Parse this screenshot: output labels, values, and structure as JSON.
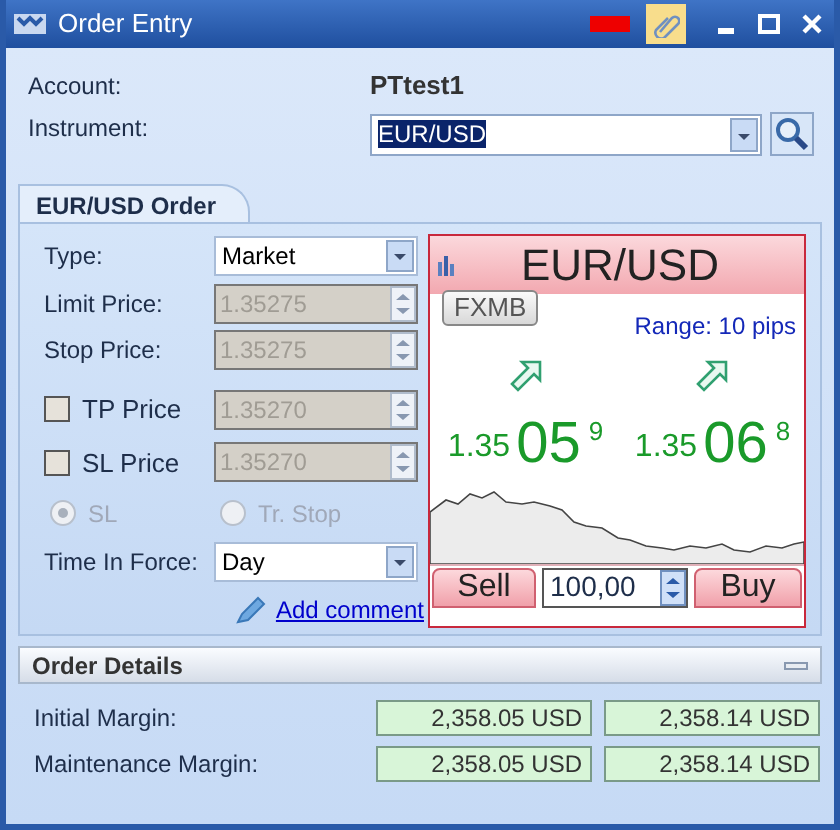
{
  "window": {
    "title": "Order Entry"
  },
  "account": {
    "label": "Account:",
    "value": "PTtest1"
  },
  "instrument": {
    "label": "Instrument:",
    "value": "EUR/USD"
  },
  "tabs": [
    {
      "label": "EUR/USD Order",
      "selected": true
    }
  ],
  "fields": [
    {
      "kind": "select",
      "label": "Type:",
      "value": "Market",
      "disabled": false
    },
    {
      "kind": "spin",
      "label": "Limit Price:",
      "value": "1.35275",
      "disabled": true
    },
    {
      "kind": "spin",
      "label": "Stop Price:",
      "value": "1.35275",
      "disabled": true
    },
    {
      "kind": "check_spin",
      "label": "TP Price",
      "checked": false,
      "value": "1.35270",
      "disabled": true
    },
    {
      "kind": "check_spin",
      "label": "SL Price",
      "checked": false,
      "value": "1.35270",
      "disabled": true
    },
    {
      "kind": "radios",
      "disabled": true,
      "options": [
        {
          "label": "SL",
          "selected": true
        },
        {
          "label": "Tr. Stop",
          "selected": false
        }
      ]
    },
    {
      "kind": "select",
      "label": "Time In Force:",
      "value": "Day",
      "disabled": false
    }
  ],
  "add_comment": "Add comment",
  "quote": {
    "symbol": "EUR/USD",
    "source": "FXMB",
    "range": "Range: 10 pips",
    "prices": [
      {
        "prefix": "1.35",
        "big": "05",
        "pip": "9"
      },
      {
        "prefix": "1.35",
        "big": "06",
        "pip": "8"
      }
    ],
    "sell_button": "Sell",
    "amount": "100,00",
    "buy_button": "Buy"
  },
  "order_details": {
    "title": "Order Details",
    "expanded": true,
    "rows": [
      {
        "label": "Initial Margin:",
        "values": [
          "2,358.05 USD",
          "2,358.14 USD"
        ]
      },
      {
        "label": "Maintenance Margin:",
        "values": [
          "2,358.05 USD",
          "2,358.14 USD"
        ]
      }
    ]
  }
}
